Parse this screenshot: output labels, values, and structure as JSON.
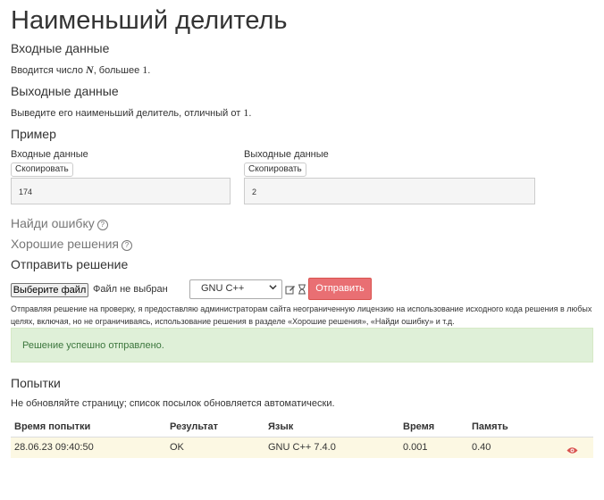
{
  "title": "Наименьший делитель",
  "input_section": {
    "heading": "Входные данные",
    "text_before": "Вводится число ",
    "var_n": "N",
    "text_middle": ", большее ",
    "num_one": "1",
    "text_after": "."
  },
  "output_section": {
    "heading": "Выходные данные",
    "text_before": "Выведите его наименьший делитель, отличный от ",
    "num_one": "1",
    "text_after": "."
  },
  "example": {
    "heading": "Пример",
    "input_label": "Входные данные",
    "output_label": "Выходные данные",
    "copy_label": "Скопировать",
    "input_value": "174",
    "output_value": "2"
  },
  "find_error": "Найди ошибку",
  "good_solutions": "Хорошие решения",
  "help_icon_glyph": "?",
  "submit": {
    "heading": "Отправить решение",
    "file_button": "Выберите файл",
    "file_status": "Файл не выбран",
    "language": "GNU C++",
    "send_button": "Отправить",
    "license_line1": "Отправляя решение на проверку, я предоставляю администраторам сайта неограниченную лицензию на использование исходного кода решения в любых",
    "license_line2": "целях, включая, но не ограничиваясь, использование решения в разделе «Хорошие решения», «Найди ошибку» и т.д."
  },
  "alert": {
    "message": "Решение успешно отправлено.",
    "color": "#dff0d8"
  },
  "attempts": {
    "heading": "Попытки",
    "note": "Не обновляйте страницу; список посылок обновляется автоматически.",
    "columns": [
      "Время попытки",
      "Результат",
      "Язык",
      "Время",
      "Память"
    ],
    "rows": [
      {
        "time": "28.06.23 09:40:50",
        "result": "OK",
        "language": "GNU C++ 7.4.0",
        "duration": "0.001",
        "memory": "0.40",
        "icon": "eye-icon"
      }
    ]
  },
  "colors": {
    "send_button": "#e96f73",
    "row_highlight": "#fcf8e3",
    "eye_icon": "#d9534f"
  }
}
